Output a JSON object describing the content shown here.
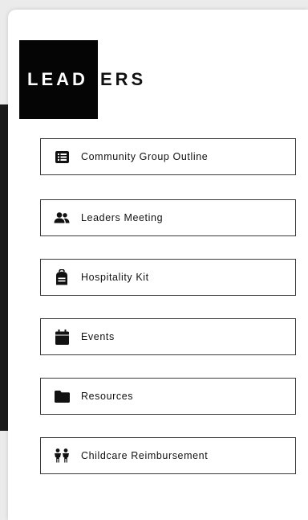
{
  "logo": {
    "part1": "LEAD",
    "part2": "ERS"
  },
  "menu": [
    {
      "label": "Community Group Outline",
      "icon": "list-icon"
    },
    {
      "label": "Leaders Meeting",
      "icon": "users-icon"
    },
    {
      "label": "Hospitality Kit",
      "icon": "backpack-icon"
    },
    {
      "label": "Events",
      "icon": "calendar-icon"
    },
    {
      "label": "Resources",
      "icon": "folder-icon"
    },
    {
      "label": "Childcare Reimbursement",
      "icon": "children-icon"
    }
  ],
  "colors": {
    "logo_bg": "#050505",
    "border": "#3a3a3a",
    "text": "#111111"
  }
}
